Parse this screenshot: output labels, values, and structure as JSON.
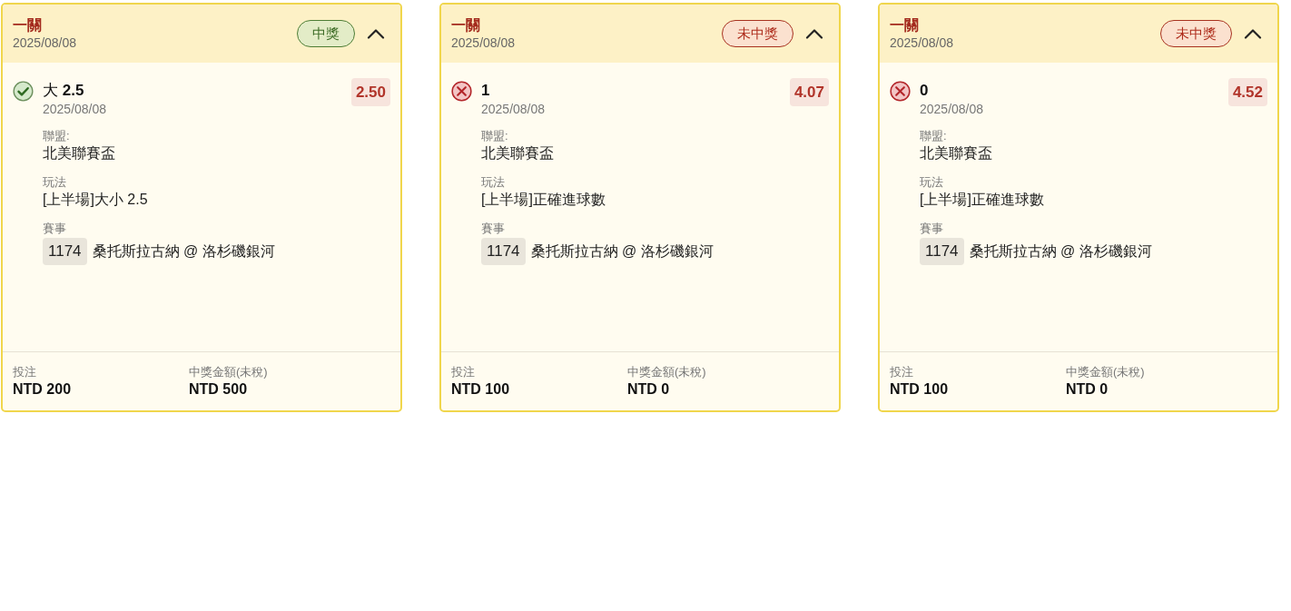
{
  "cards": [
    {
      "title": "一關",
      "date": "2025/08/08",
      "won": true,
      "status": "中獎",
      "expanded": true,
      "pick": {
        "prefix": "大",
        "value": "2.5"
      },
      "odds": "2.50",
      "pick_date": "2025/08/08",
      "details": [
        {
          "kind": "text",
          "label": "聯盟:",
          "value": "北美聯賽盃"
        },
        {
          "kind": "text",
          "label": "玩法",
          "value": "[上半場]大小 2.5"
        },
        {
          "kind": "match",
          "label": "賽事",
          "number": "1174",
          "value": "桑托斯拉古納 @ 洛杉磯銀河"
        }
      ],
      "summary": [
        {
          "label": "投注",
          "value": "NTD 200"
        },
        {
          "label": "中獎金額(未稅)",
          "value": "NTD 500"
        }
      ]
    },
    {
      "title": "一關",
      "date": "2025/08/08",
      "won": false,
      "status": "未中獎",
      "expanded": true,
      "pick": {
        "value": "1"
      },
      "odds": "4.07",
      "pick_date": "2025/08/08",
      "details": [
        {
          "kind": "text",
          "label": "聯盟:",
          "value": "北美聯賽盃"
        },
        {
          "kind": "text",
          "label": "玩法",
          "value": "[上半場]正確進球數"
        },
        {
          "kind": "match",
          "label": "賽事",
          "number": "1174",
          "value": "桑托斯拉古納 @ 洛杉磯銀河"
        }
      ],
      "summary": [
        {
          "label": "投注",
          "value": "NTD 100"
        },
        {
          "label": "中獎金額(未稅)",
          "value": "NTD 0"
        }
      ]
    },
    {
      "title": "一關",
      "date": "2025/08/08",
      "won": false,
      "status": "未中獎",
      "expanded": true,
      "pick": {
        "value": "0"
      },
      "odds": "4.52",
      "pick_date": "2025/08/08",
      "details": [
        {
          "kind": "text",
          "label": "聯盟:",
          "value": "北美聯賽盃"
        },
        {
          "kind": "text",
          "label": "玩法",
          "value": "[上半場]正確進球數"
        },
        {
          "kind": "match",
          "label": "賽事",
          "number": "1174",
          "value": "桑托斯拉古納 @ 洛杉磯銀河"
        }
      ],
      "summary": [
        {
          "label": "投注",
          "value": "NTD 100"
        },
        {
          "label": "中獎金額(未稅)",
          "value": "NTD 0"
        }
      ]
    }
  ]
}
